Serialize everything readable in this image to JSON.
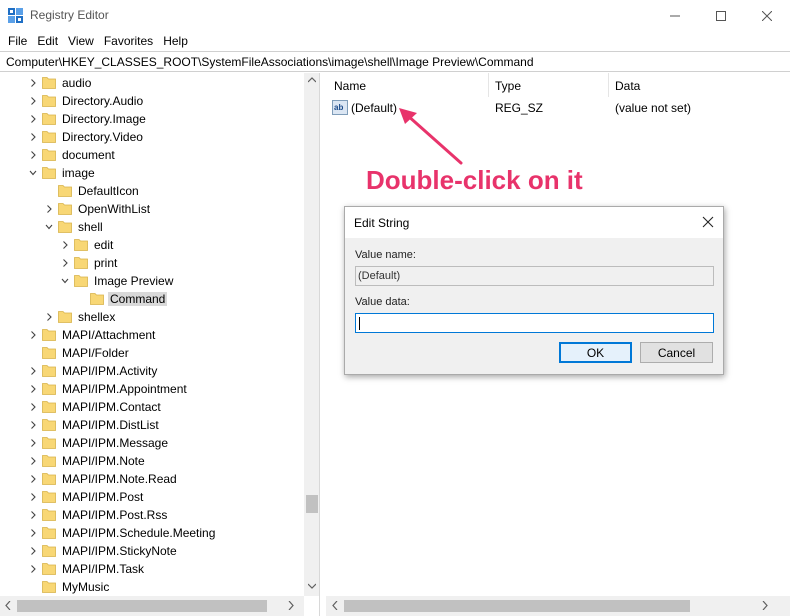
{
  "window": {
    "title": "Registry Editor"
  },
  "menu": [
    "File",
    "Edit",
    "View",
    "Favorites",
    "Help"
  ],
  "address": "Computer\\HKEY_CLASSES_ROOT\\SystemFileAssociations\\image\\shell\\Image Preview\\Command",
  "tree": [
    {
      "label": "audio",
      "level": 0,
      "chevron": "right"
    },
    {
      "label": "Directory.Audio",
      "level": 0,
      "chevron": "right"
    },
    {
      "label": "Directory.Image",
      "level": 0,
      "chevron": "right"
    },
    {
      "label": "Directory.Video",
      "level": 0,
      "chevron": "right"
    },
    {
      "label": "document",
      "level": 0,
      "chevron": "right"
    },
    {
      "label": "image",
      "level": 0,
      "chevron": "down"
    },
    {
      "label": "DefaultIcon",
      "level": 1,
      "chevron": "none"
    },
    {
      "label": "OpenWithList",
      "level": 1,
      "chevron": "right"
    },
    {
      "label": "shell",
      "level": 1,
      "chevron": "down"
    },
    {
      "label": "edit",
      "level": 2,
      "chevron": "right"
    },
    {
      "label": "print",
      "level": 2,
      "chevron": "right"
    },
    {
      "label": "Image Preview",
      "level": 2,
      "chevron": "down"
    },
    {
      "label": "Command",
      "level": 3,
      "chevron": "none",
      "selected": true
    },
    {
      "label": "shellex",
      "level": 1,
      "chevron": "right"
    },
    {
      "label": "MAPI/Attachment",
      "level": 0,
      "chevron": "right"
    },
    {
      "label": "MAPI/Folder",
      "level": 0,
      "chevron": "none"
    },
    {
      "label": "MAPI/IPM.Activity",
      "level": 0,
      "chevron": "right"
    },
    {
      "label": "MAPI/IPM.Appointment",
      "level": 0,
      "chevron": "right"
    },
    {
      "label": "MAPI/IPM.Contact",
      "level": 0,
      "chevron": "right"
    },
    {
      "label": "MAPI/IPM.DistList",
      "level": 0,
      "chevron": "right"
    },
    {
      "label": "MAPI/IPM.Message",
      "level": 0,
      "chevron": "right"
    },
    {
      "label": "MAPI/IPM.Note",
      "level": 0,
      "chevron": "right"
    },
    {
      "label": "MAPI/IPM.Note.Read",
      "level": 0,
      "chevron": "right"
    },
    {
      "label": "MAPI/IPM.Post",
      "level": 0,
      "chevron": "right"
    },
    {
      "label": "MAPI/IPM.Post.Rss",
      "level": 0,
      "chevron": "right"
    },
    {
      "label": "MAPI/IPM.Schedule.Meeting",
      "level": 0,
      "chevron": "right"
    },
    {
      "label": "MAPI/IPM.StickyNote",
      "level": 0,
      "chevron": "right"
    },
    {
      "label": "MAPI/IPM.Task",
      "level": 0,
      "chevron": "right"
    },
    {
      "label": "MyMusic",
      "level": 0,
      "chevron": "none"
    }
  ],
  "columns": {
    "name": "Name",
    "type": "Type",
    "data": "Data"
  },
  "values": [
    {
      "name": "(Default)",
      "type": "REG_SZ",
      "data": "(value not set)",
      "icon": "ab"
    }
  ],
  "annotation": "Double-click on it",
  "dialog": {
    "title": "Edit String",
    "value_name_label": "Value name:",
    "value_name": "(Default)",
    "value_data_label": "Value data:",
    "value_data": "",
    "ok_label": "OK",
    "cancel_label": "Cancel"
  },
  "colors": {
    "annotation": "#e8336b",
    "folder": "#f8d775",
    "accent": "#0078d7"
  }
}
